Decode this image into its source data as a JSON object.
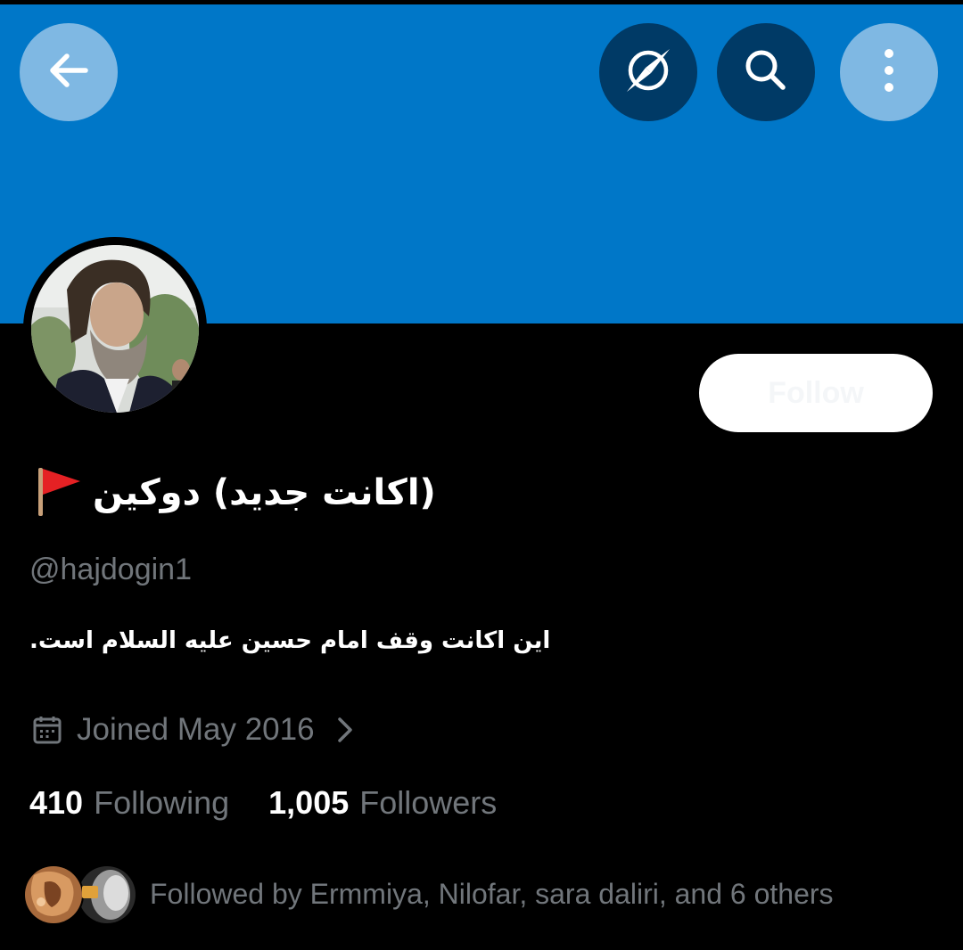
{
  "header": {
    "back_icon": "arrow-left-icon",
    "explore_icon": "compass-icon",
    "search_icon": "search-icon",
    "more_icon": "more-vertical-icon",
    "banner_color": "#0077c8"
  },
  "profile": {
    "display_name": "(اکانت جدید) دوکین",
    "flag_emoji": "red-triangular-flag-icon",
    "handle": "@hajdogin1",
    "bio": "این اکانت وقف امام حسین علیه السلام است.",
    "joined": "Joined May 2016",
    "follow_label": "Follow"
  },
  "stats": {
    "following_count": "410",
    "following_label": "Following",
    "followers_count": "1,005",
    "followers_label": "Followers"
  },
  "followed_by": {
    "text": "Followed by Ermmiya, Nilofar, sara daliri, and 6 others"
  }
}
